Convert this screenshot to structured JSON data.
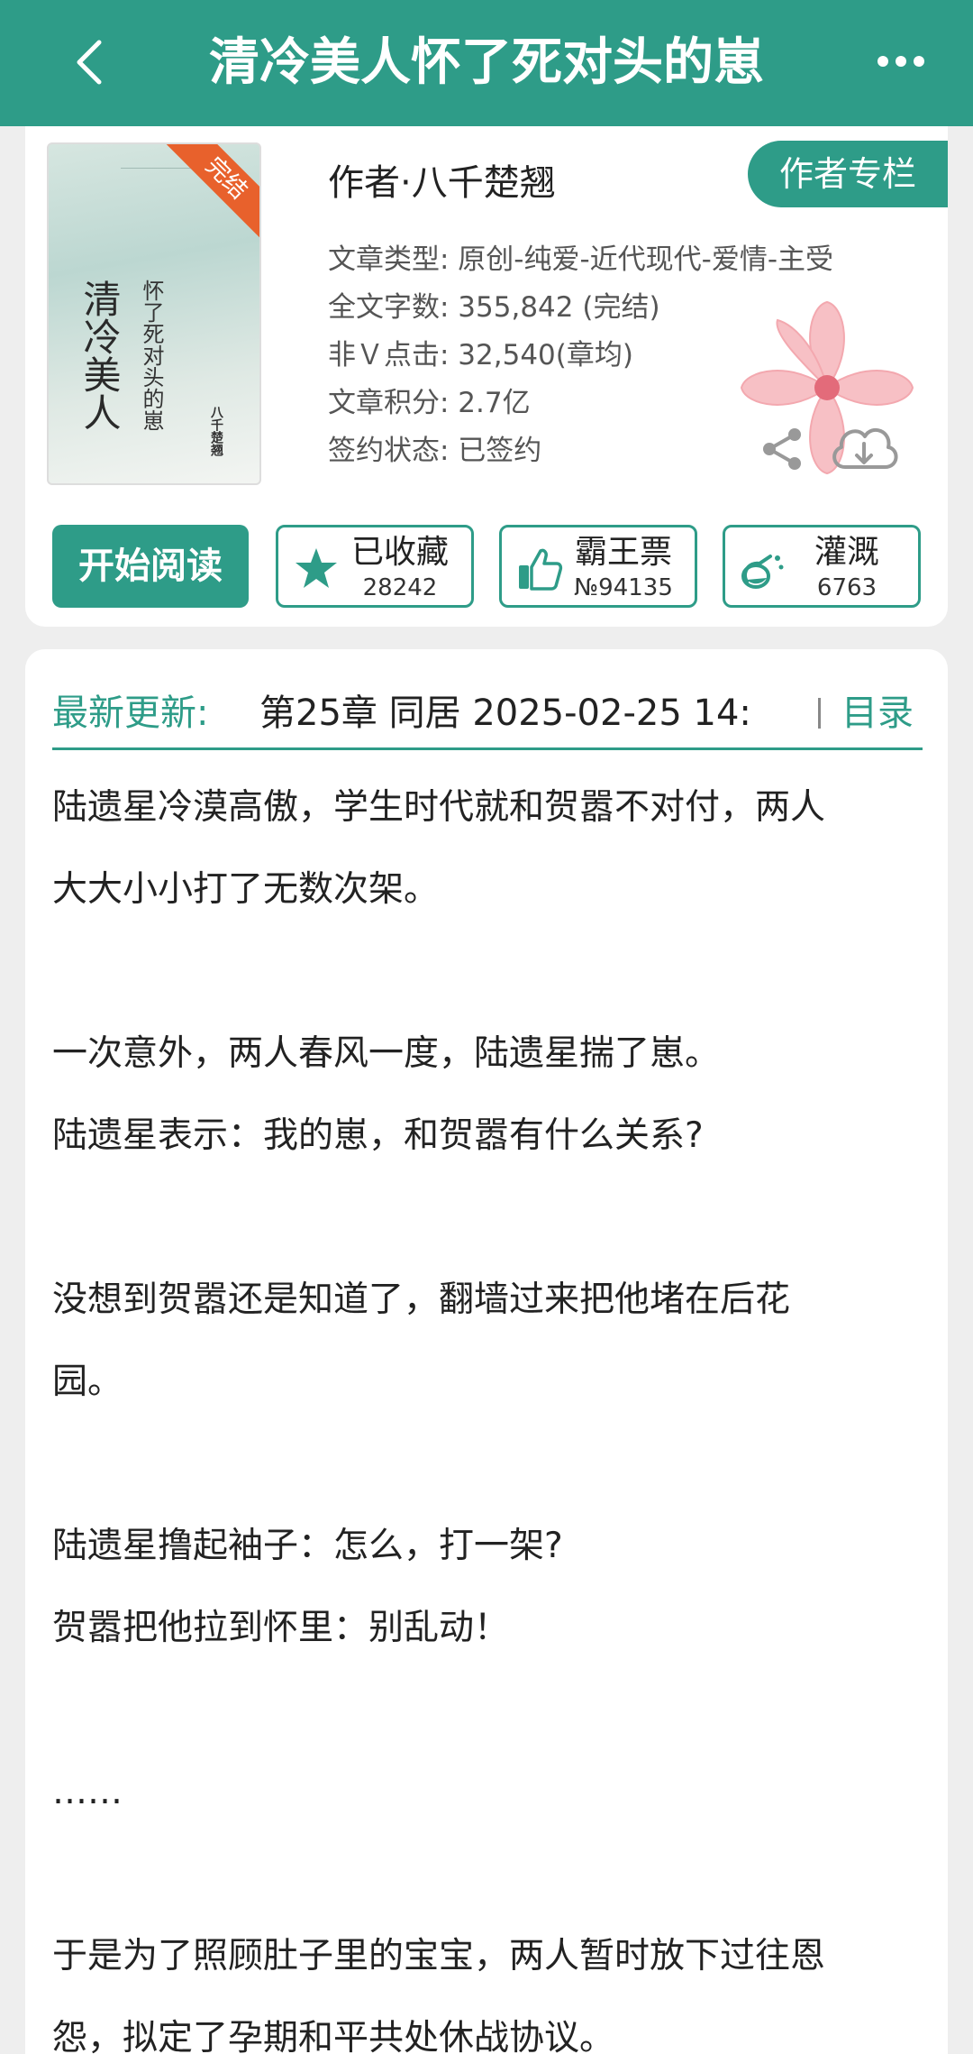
{
  "header": {
    "title": "清冷美人怀了死对头的崽",
    "back_icon": "chevron-left-icon",
    "more_icon": "more-dots-icon"
  },
  "cover": {
    "badge": "完结",
    "title_big": "清冷美人",
    "title_small": "怀了死对头的崽",
    "author_small": "八千楚翘"
  },
  "book": {
    "author": "作者·八千楚翘",
    "column_button": "作者专栏",
    "meta": [
      "文章类型: 原创-纯爱-近代现代-爱情-主受",
      "全文字数: 355,842 (完结)",
      "非Ｖ点击: 32,540(章均)",
      "文章积分: 2.7亿",
      "签约状态: 已签约"
    ]
  },
  "actions": {
    "start": "开始阅读",
    "collect": {
      "label": "已收藏",
      "count": "28242"
    },
    "ticket": {
      "label": "霸王票",
      "count": "№94135"
    },
    "water": {
      "label": "灌溉",
      "count": "6763"
    }
  },
  "latest": {
    "label": "最新更新:",
    "value": "第25章  同居  2025-02-25 14:",
    "toc": "目录"
  },
  "summary": [
    "陆遗星冷漠高傲，学生时代就和贺嚣不对付，两人",
    "大大小小打了无数次架。",
    "",
    "一次意外，两人春风一度，陆遗星揣了崽。",
    "陆遗星表示：我的崽，和贺嚣有什么关系?",
    "",
    "没想到贺嚣还是知道了，翻墙过来把他堵在后花",
    "园。",
    "",
    "陆遗星撸起袖子：怎么，打一架?",
    "贺嚣把他拉到怀里：别乱动！",
    "",
    "……",
    "",
    "于是为了照顾肚子里的宝宝，两人暂时放下过往恩",
    "怨，拟定了孕期和平共处休战协议。"
  ],
  "colors": {
    "accent": "#2e9c88",
    "badge": "#e8612c",
    "page_bg": "#eeeeee"
  }
}
